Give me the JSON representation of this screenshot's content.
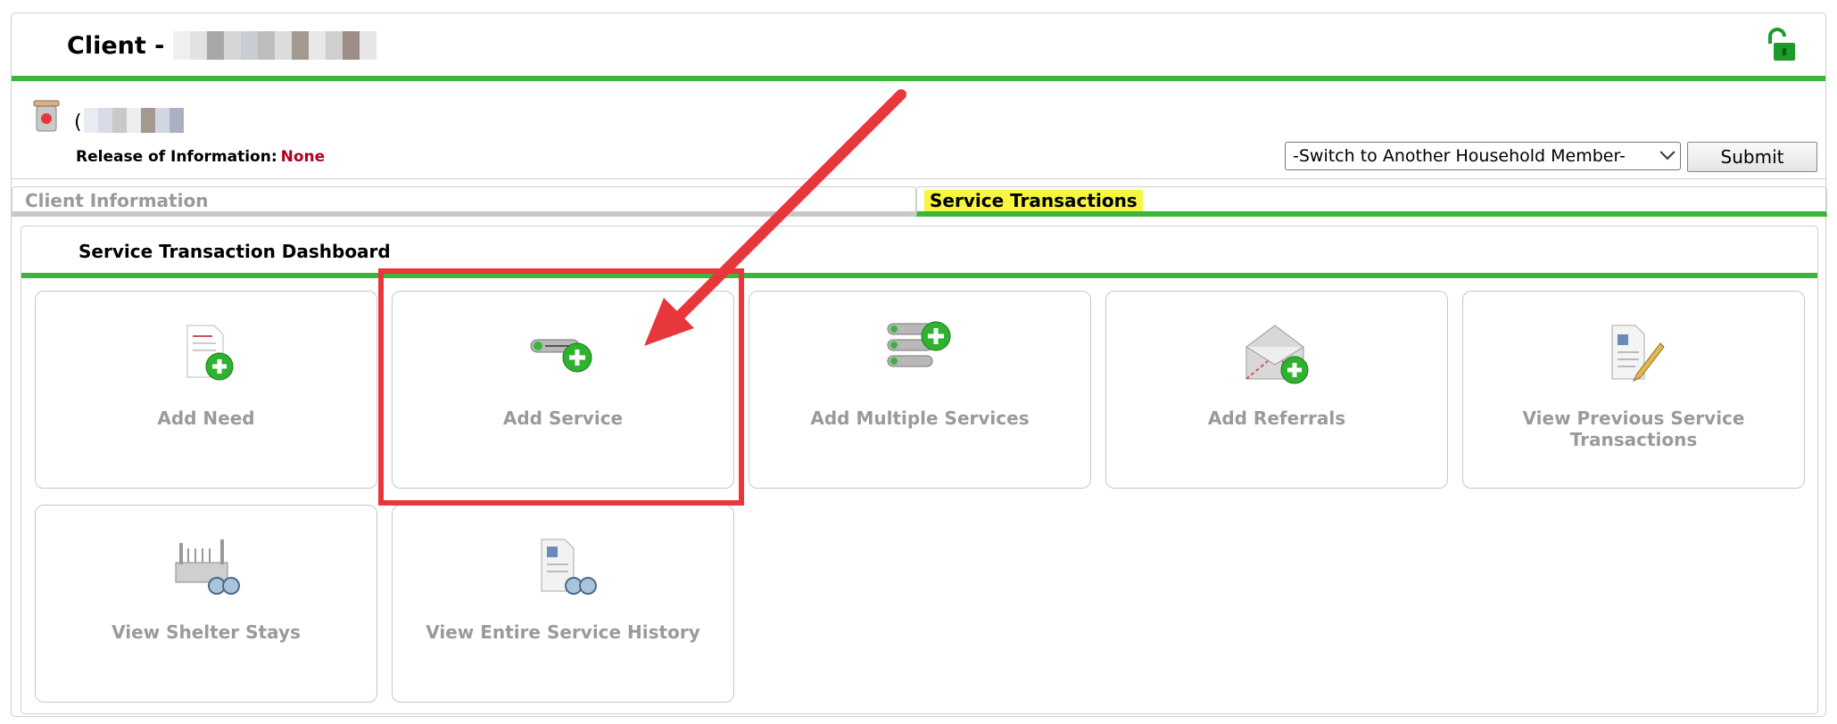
{
  "header": {
    "client_label": "Client -",
    "lock_icon": "unlock-icon",
    "accent_color": "#3cb53a"
  },
  "summary": {
    "paren": "(",
    "roi_label": "Release of Information:",
    "roi_value": "None",
    "switch_member_select": "-Switch to Another Household Member-",
    "submit_label": "Submit"
  },
  "tabs": [
    {
      "label": "Client Information",
      "active": false
    },
    {
      "label": "Service Transactions",
      "active": true
    }
  ],
  "dashboard": {
    "title": "Service Transaction Dashboard",
    "tiles": [
      {
        "label": "Add Need",
        "icon": "add-need-icon"
      },
      {
        "label": "Add Service",
        "icon": "add-service-icon"
      },
      {
        "label": "Add Multiple Services",
        "icon": "add-multiple-services-icon"
      },
      {
        "label": "Add Referrals",
        "icon": "add-referrals-icon"
      },
      {
        "label": "View Previous Service Transactions",
        "icon": "view-previous-transactions-icon"
      },
      {
        "label": "View Shelter Stays",
        "icon": "view-shelter-stays-icon"
      },
      {
        "label": "View Entire Service History",
        "icon": "view-service-history-icon"
      }
    ]
  }
}
